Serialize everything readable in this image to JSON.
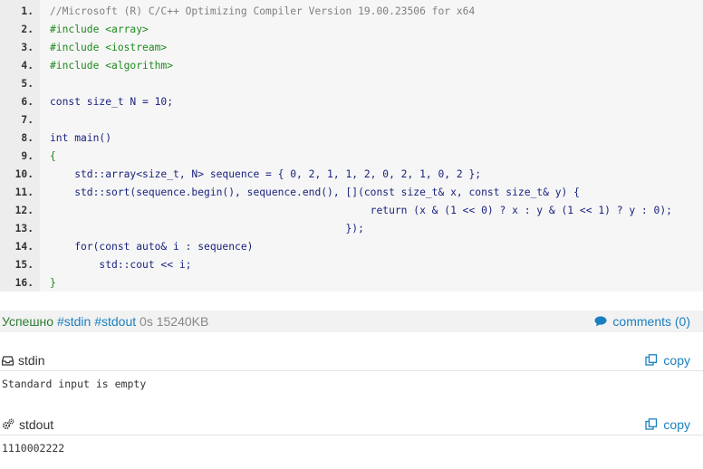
{
  "code": {
    "lines": [
      {
        "n": "1.",
        "tokens": [
          {
            "t": "//Microsoft (R) C/C++ Optimizing Compiler Version 19.00.23506 for x64",
            "c": "comment"
          }
        ]
      },
      {
        "n": "2.",
        "tokens": [
          {
            "t": "#include <array>",
            "c": "prep"
          }
        ]
      },
      {
        "n": "3.",
        "tokens": [
          {
            "t": "#include <iostream>",
            "c": "prep"
          }
        ]
      },
      {
        "n": "4.",
        "tokens": [
          {
            "t": "#include <algorithm>",
            "c": "prep"
          }
        ]
      },
      {
        "n": "5.",
        "tokens": []
      },
      {
        "n": "6.",
        "tokens": [
          {
            "t": "const size_t N = 10;",
            "c": "ident"
          }
        ]
      },
      {
        "n": "7.",
        "tokens": []
      },
      {
        "n": "8.",
        "tokens": [
          {
            "t": "int main()",
            "c": "ident"
          }
        ]
      },
      {
        "n": "9.",
        "tokens": [
          {
            "t": "{",
            "c": "prep"
          }
        ]
      },
      {
        "n": "10.",
        "tokens": [
          {
            "t": "    std::array<size_t, N> sequence = { 0, 2, 1, 1, 2, 0, 2, 1, 0, 2 };",
            "c": "ident"
          }
        ]
      },
      {
        "n": "11.",
        "tokens": [
          {
            "t": "    std::sort(sequence.begin(), sequence.end(), [](const size_t& x, const size_t& y) {",
            "c": "ident"
          }
        ]
      },
      {
        "n": "12.",
        "tokens": [
          {
            "t": "                                                    return (x & (1 << 0) ? x : y & (1 << 1) ? y : 0);",
            "c": "ident"
          }
        ]
      },
      {
        "n": "13.",
        "tokens": [
          {
            "t": "                                                });",
            "c": "ident"
          }
        ]
      },
      {
        "n": "14.",
        "tokens": [
          {
            "t": "    for(const auto& i : sequence)",
            "c": "ident"
          }
        ]
      },
      {
        "n": "15.",
        "tokens": [
          {
            "t": "        std::cout << i;",
            "c": "ident"
          }
        ]
      },
      {
        "n": "16.",
        "tokens": [
          {
            "t": "}",
            "c": "prep"
          }
        ]
      }
    ]
  },
  "status": {
    "result": "Успешно",
    "tags": "#stdin #stdout",
    "time": "0s",
    "memory": "15240KB",
    "comments_label": "comments (0)"
  },
  "stdin": {
    "label": "stdin",
    "copy_label": "copy",
    "content": "Standard input is empty"
  },
  "stdout": {
    "label": "stdout",
    "copy_label": "copy",
    "content": "1110002222"
  },
  "colors": {
    "success": "#2e7d32",
    "link": "#1a7fc0",
    "comment": "#7f7f7f",
    "preprocessor": "#1f8a1f",
    "code": "#1a237e"
  },
  "icons": {
    "comments": "speech-bubble-icon",
    "stdin": "inbox-icon",
    "stdout": "gears-icon",
    "copy": "copy-icon"
  }
}
